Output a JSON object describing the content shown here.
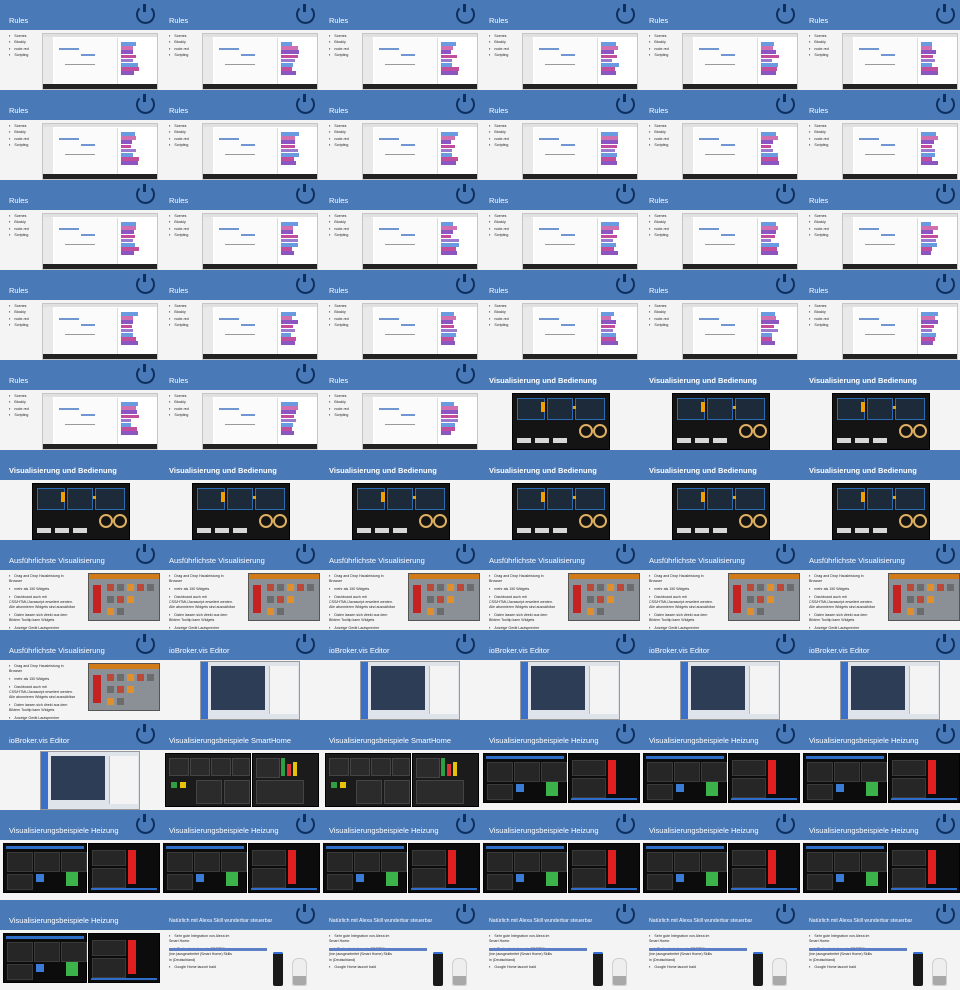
{
  "accent": "#4a79b8",
  "logo_icon": "iobroker-logo-icon",
  "titles": {
    "rules": "Rules",
    "vis_bedienung": "Visualisierung und Bedienung",
    "ausf_vis": "Ausführlichste Visualisierung",
    "editor": "ioBroker.vis Editor",
    "vis_smarthome": "Visualisierungsbeispiele SmartHome",
    "vis_heizung": "Visualisierungsbeispiele Heizung",
    "alexa": "Natürlich mit Alexa Skill wunderbar steuerbar"
  },
  "rules_items": [
    "Scenes",
    "Blockly",
    "node-red",
    "Scripting"
  ],
  "vis_items": [
    "Drag and Drop Hausleistung in Browser",
    "mehr als 150 Widgets",
    "Dashboard auch mit CSS/HTML/Javascript erweitert werden. Alle abonnieren Widgets sind auswählbar",
    "Daten lassen sich direkt aus dem Bildern Tooltip kann Widgets",
    "Anzeige Gerät Lautsprecher",
    "Einstellungen optimierte apps: Die Status sind geladen um hidden Traffic zu optimieren."
  ],
  "alexa_items": [
    "Sehr gute Integration von Alexa im Smart Home.",
    "ioBroker hat einen der BESTEN, (ine.)ausgearbeitet (Smart Home) Skills in (Deutschland)",
    "Google Home launch bald"
  ],
  "slides": [
    {
      "type": "rules"
    },
    {
      "type": "rules"
    },
    {
      "type": "rules"
    },
    {
      "type": "rules"
    },
    {
      "type": "rules"
    },
    {
      "type": "rules"
    },
    {
      "type": "rules"
    },
    {
      "type": "rules"
    },
    {
      "type": "rules"
    },
    {
      "type": "rules"
    },
    {
      "type": "rules"
    },
    {
      "type": "rules"
    },
    {
      "type": "rules"
    },
    {
      "type": "rules"
    },
    {
      "type": "rules"
    },
    {
      "type": "rules"
    },
    {
      "type": "rules"
    },
    {
      "type": "rules"
    },
    {
      "type": "rules"
    },
    {
      "type": "rules"
    },
    {
      "type": "rules"
    },
    {
      "type": "rules"
    },
    {
      "type": "rules"
    },
    {
      "type": "rules"
    },
    {
      "type": "rules"
    },
    {
      "type": "rules"
    },
    {
      "type": "rules"
    },
    {
      "type": "vis_bedienung"
    },
    {
      "type": "vis_bedienung"
    },
    {
      "type": "vis_bedienung"
    },
    {
      "type": "vis_bedienung"
    },
    {
      "type": "vis_bedienung"
    },
    {
      "type": "vis_bedienung"
    },
    {
      "type": "vis_bedienung"
    },
    {
      "type": "vis_bedienung"
    },
    {
      "type": "vis_bedienung"
    },
    {
      "type": "ausf_vis"
    },
    {
      "type": "ausf_vis"
    },
    {
      "type": "ausf_vis"
    },
    {
      "type": "ausf_vis"
    },
    {
      "type": "ausf_vis"
    },
    {
      "type": "ausf_vis"
    },
    {
      "type": "ausf_vis"
    },
    {
      "type": "editor"
    },
    {
      "type": "editor"
    },
    {
      "type": "editor"
    },
    {
      "type": "editor"
    },
    {
      "type": "editor"
    },
    {
      "type": "editor"
    },
    {
      "type": "vis_smarthome"
    },
    {
      "type": "vis_smarthome"
    },
    {
      "type": "vis_heizung"
    },
    {
      "type": "vis_heizung"
    },
    {
      "type": "vis_heizung"
    },
    {
      "type": "vis_heizung"
    },
    {
      "type": "vis_heizung"
    },
    {
      "type": "vis_heizung"
    },
    {
      "type": "vis_heizung"
    },
    {
      "type": "vis_heizung"
    },
    {
      "type": "vis_heizung"
    },
    {
      "type": "vis_heizung"
    },
    {
      "type": "alexa"
    },
    {
      "type": "alexa"
    },
    {
      "type": "alexa"
    },
    {
      "type": "alexa"
    },
    {
      "type": "alexa"
    }
  ]
}
